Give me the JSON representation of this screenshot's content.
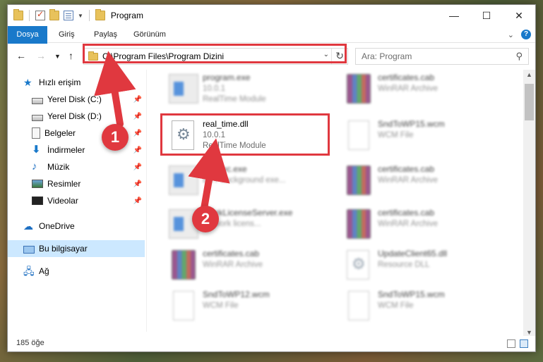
{
  "window": {
    "title": "Program"
  },
  "ribbon": {
    "tabs": [
      "Dosya",
      "Giriş",
      "Paylaş",
      "Görünüm"
    ]
  },
  "nav": {
    "address": "C:\\Program Files\\Program Dizini",
    "search_placeholder": "Ara: Program"
  },
  "sidebar": {
    "items": [
      {
        "label": "Hızlı erişim",
        "icon": "star-icon"
      },
      {
        "label": "Yerel Disk (C:)",
        "icon": "disk-icon",
        "pinned": true
      },
      {
        "label": "Yerel Disk (D:)",
        "icon": "disk-icon",
        "pinned": true
      },
      {
        "label": "Belgeler",
        "icon": "documents-icon",
        "pinned": true
      },
      {
        "label": "İndirmeler",
        "icon": "download-icon",
        "pinned": true
      },
      {
        "label": "Müzik",
        "icon": "music-icon",
        "pinned": true
      },
      {
        "label": "Resimler",
        "icon": "pictures-icon",
        "pinned": true
      },
      {
        "label": "Videolar",
        "icon": "videos-icon",
        "pinned": true
      },
      {
        "label": "OneDrive",
        "icon": "cloud-icon"
      },
      {
        "label": "Bu bilgisayar",
        "icon": "computer-icon",
        "selected": true
      },
      {
        "label": "Ağ",
        "icon": "network-icon"
      }
    ]
  },
  "files": [
    {
      "name": "program.exe",
      "line2": "10.0.1",
      "line3": "RealTime Module",
      "icon": "exe-icon"
    },
    {
      "name": "certificates.cab",
      "line2": "WinRAR Archive",
      "line3": "",
      "icon": "rar-icon"
    },
    {
      "name": "real_time.dll",
      "line2": "10.0.1",
      "line3": "RealTime Module",
      "icon": "dll-icon"
    },
    {
      "name": "SndToWP15.wcm",
      "line2": "WCM File",
      "line3": "",
      "icon": "page-icon"
    },
    {
      "name": "neExec.exe",
      "line2": "BBY background exe...",
      "line3": "",
      "icon": "exe-icon"
    },
    {
      "name": "certificates.cab",
      "line2": "WinRAR Archive",
      "line3": "",
      "icon": "rar-icon"
    },
    {
      "name": "tworkLicenseServer.exe",
      "line2": "network licens...",
      "line3": "",
      "icon": "exe-icon"
    },
    {
      "name": "certificates.cab",
      "line2": "WinRAR Archive",
      "line3": "",
      "icon": "rar-icon"
    },
    {
      "name": "certificates.cab",
      "line2": "WinRAR Archive",
      "line3": "",
      "icon": "rar-icon"
    },
    {
      "name": "UpdateClient65.dll",
      "line2": "Resource DLL",
      "line3": "",
      "icon": "dll-icon"
    },
    {
      "name": "SndToWP12.wcm",
      "line2": "WCM File",
      "line3": "",
      "icon": "page-icon"
    },
    {
      "name": "SndToWP15.wcm",
      "line2": "WCM File",
      "line3": "",
      "icon": "page-icon"
    }
  ],
  "status": {
    "count": "185 öğe"
  },
  "callouts": [
    "1",
    "2"
  ],
  "colors": {
    "accent": "#1979ca",
    "highlight": "#e0383f",
    "selection": "#cce8ff"
  }
}
